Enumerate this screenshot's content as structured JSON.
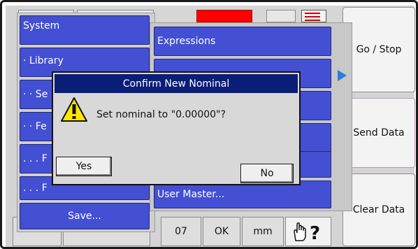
{
  "right_buttons": {
    "go_stop": "Go / Stop",
    "send_data": "Send Data",
    "clear_data": "Clear Data"
  },
  "main_menu": {
    "items": [
      "System",
      "· Library",
      "· · Se",
      "· · Fe",
      ". . . F",
      ". . . F",
      "Save..."
    ]
  },
  "submenu": {
    "items": [
      "Expressions",
      "",
      "",
      "",
      "",
      "User Master..."
    ]
  },
  "bottom_bar": {
    "cell1": "07",
    "cell2": "OK",
    "cell3": "mm",
    "help_icon": "hand-question-icon"
  },
  "dialog": {
    "title": "Confirm New Nominal",
    "message": "Set nominal to \"0.00000\"?",
    "yes_label": "Yes",
    "no_label": "No",
    "icon": "warning-icon"
  },
  "colors": {
    "menu_blue": "#4350d3",
    "dialog_title_bg": "#0a1e78",
    "indicator_red": "#ff0000",
    "arrow_blue": "#2a7de1"
  }
}
